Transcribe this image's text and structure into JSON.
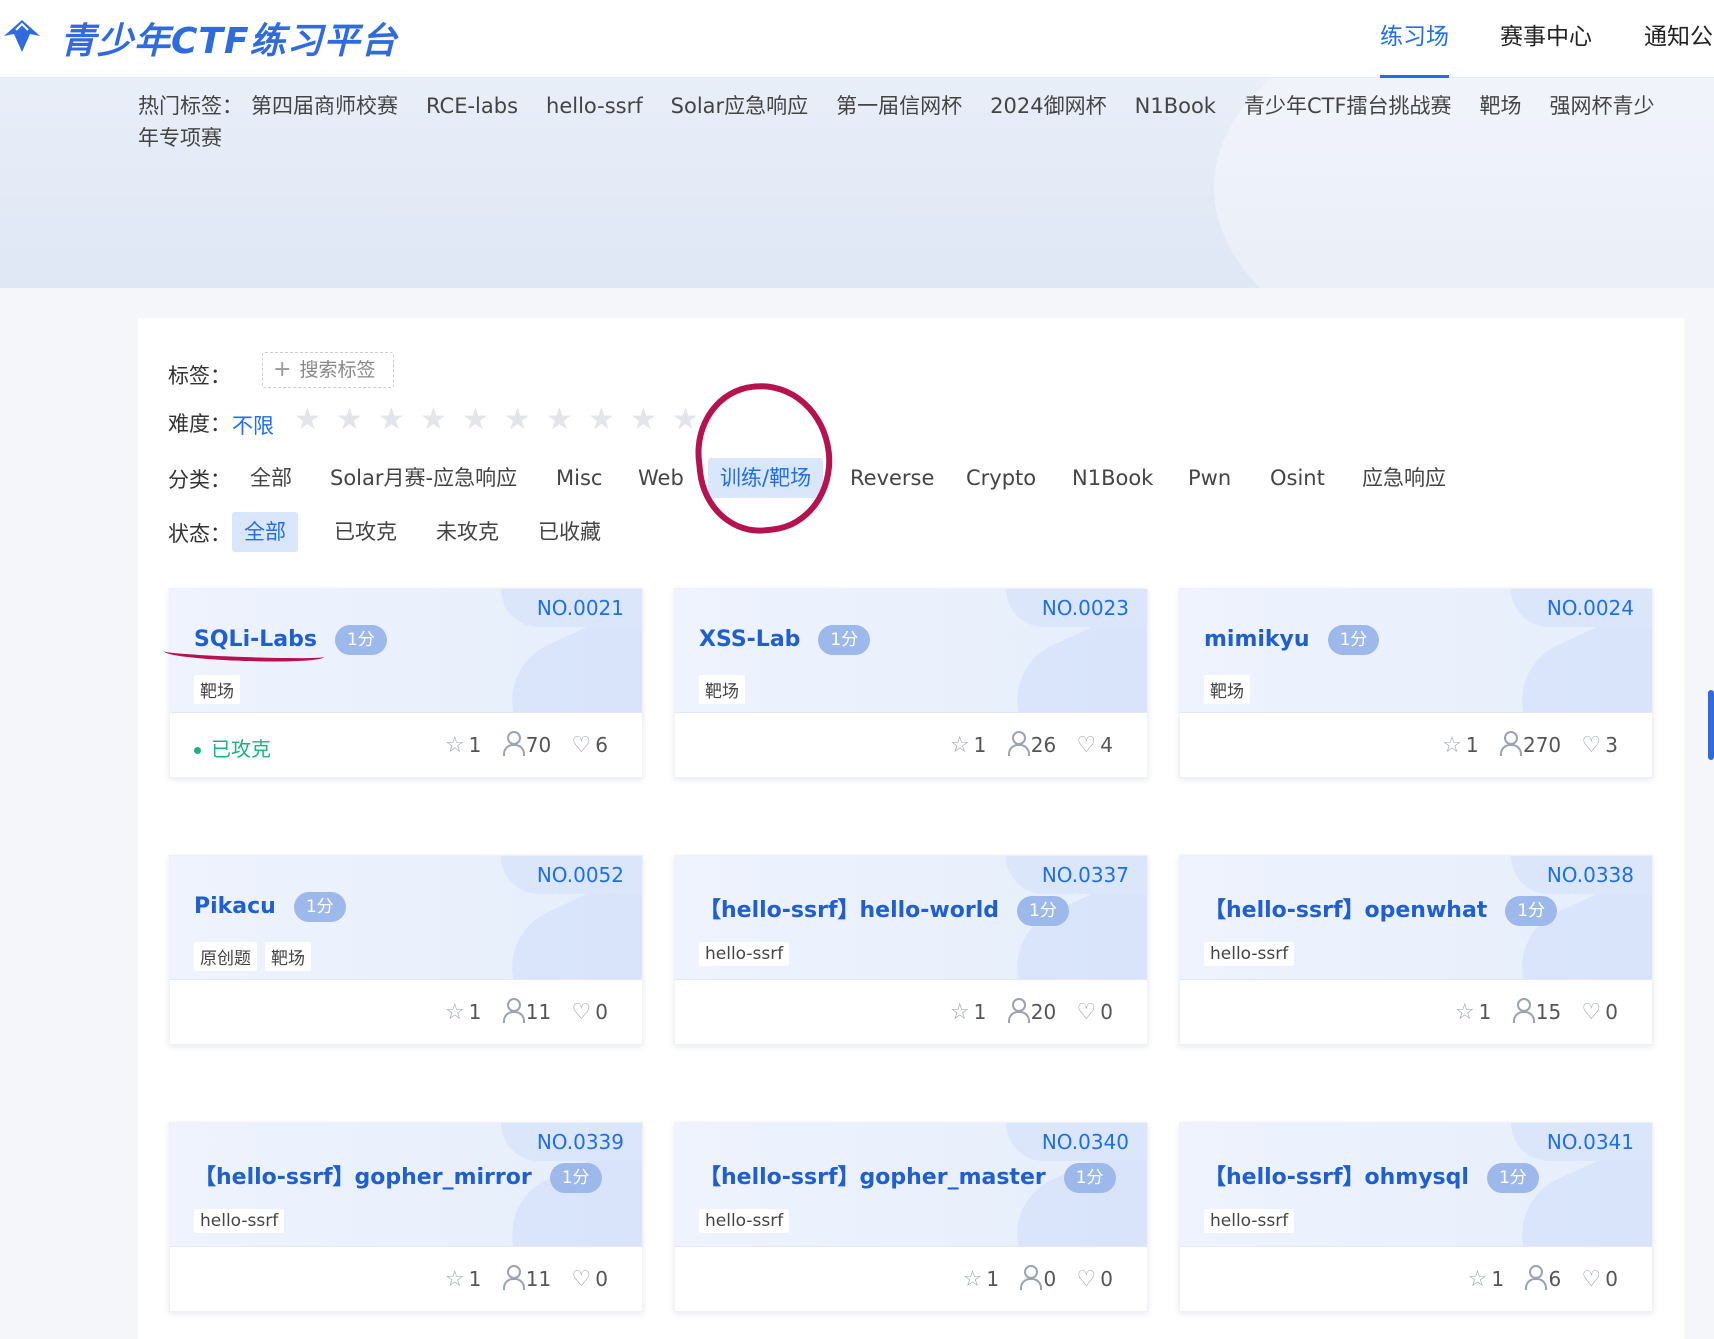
{
  "header": {
    "brand": "青少年CTF练习平台",
    "nav": [
      {
        "label": "练习场",
        "active": true
      },
      {
        "label": "赛事中心",
        "active": false
      },
      {
        "label": "通知公",
        "active": false
      }
    ]
  },
  "hot_tags": {
    "label": "热门标签：",
    "items": [
      "第四届商师校赛",
      "RCE-labs",
      "hello-ssrf",
      "Solar应急响应",
      "第一届信网杯",
      "2024御网杯",
      "N1Book",
      "青少年CTF擂台挑战赛",
      "靶场",
      "强网杯青少年专项赛"
    ]
  },
  "filters": {
    "tag_label": "标签：",
    "tag_search": "搜索标签",
    "difficulty_label": "难度：",
    "difficulty_value": "不限",
    "difficulty_stars": 10,
    "category_label": "分类：",
    "categories": [
      "全部",
      "Solar月赛-应急响应",
      "Misc",
      "Web",
      "训练/靶场",
      "Reverse",
      "Crypto",
      "N1Book",
      "Pwn",
      "Osint",
      "应急响应"
    ],
    "category_active": "训练/靶场",
    "status_label": "状态：",
    "statuses": [
      "全部",
      "已攻克",
      "未攻克",
      "已收藏"
    ],
    "status_active": "全部"
  },
  "cards": [
    {
      "no": "NO.0021",
      "title": "SQLi-Labs",
      "score": "1分",
      "tags": [
        "靶场"
      ],
      "solved": "已攻克",
      "stars": "1",
      "users": "70",
      "likes": "6"
    },
    {
      "no": "NO.0023",
      "title": "XSS-Lab",
      "score": "1分",
      "tags": [
        "靶场"
      ],
      "solved": "",
      "stars": "1",
      "users": "26",
      "likes": "4"
    },
    {
      "no": "NO.0024",
      "title": "mimikyu",
      "score": "1分",
      "tags": [
        "靶场"
      ],
      "solved": "",
      "stars": "1",
      "users": "270",
      "likes": "3"
    },
    {
      "no": "NO.0052",
      "title": "Pikacu",
      "score": "1分",
      "tags": [
        "原创题",
        "靶场"
      ],
      "solved": "",
      "stars": "1",
      "users": "11",
      "likes": "0"
    },
    {
      "no": "NO.0337",
      "title": "【hello-ssrf】hello-world",
      "score": "1分",
      "tags": [
        "hello-ssrf"
      ],
      "solved": "",
      "stars": "1",
      "users": "20",
      "likes": "0"
    },
    {
      "no": "NO.0338",
      "title": "【hello-ssrf】openwhat",
      "score": "1分",
      "tags": [
        "hello-ssrf"
      ],
      "solved": "",
      "stars": "1",
      "users": "15",
      "likes": "0"
    },
    {
      "no": "NO.0339",
      "title": "【hello-ssrf】gopher_mirror",
      "score": "1分",
      "tags": [
        "hello-ssrf"
      ],
      "solved": "",
      "stars": "1",
      "users": "11",
      "likes": "0"
    },
    {
      "no": "NO.0340",
      "title": "【hello-ssrf】gopher_master",
      "score": "1分",
      "tags": [
        "hello-ssrf"
      ],
      "solved": "",
      "stars": "1",
      "users": "0",
      "likes": "0"
    },
    {
      "no": "NO.0341",
      "title": "【hello-ssrf】ohmysql",
      "score": "1分",
      "tags": [
        "hello-ssrf"
      ],
      "solved": "",
      "stars": "1",
      "users": "6",
      "likes": "0"
    }
  ]
}
